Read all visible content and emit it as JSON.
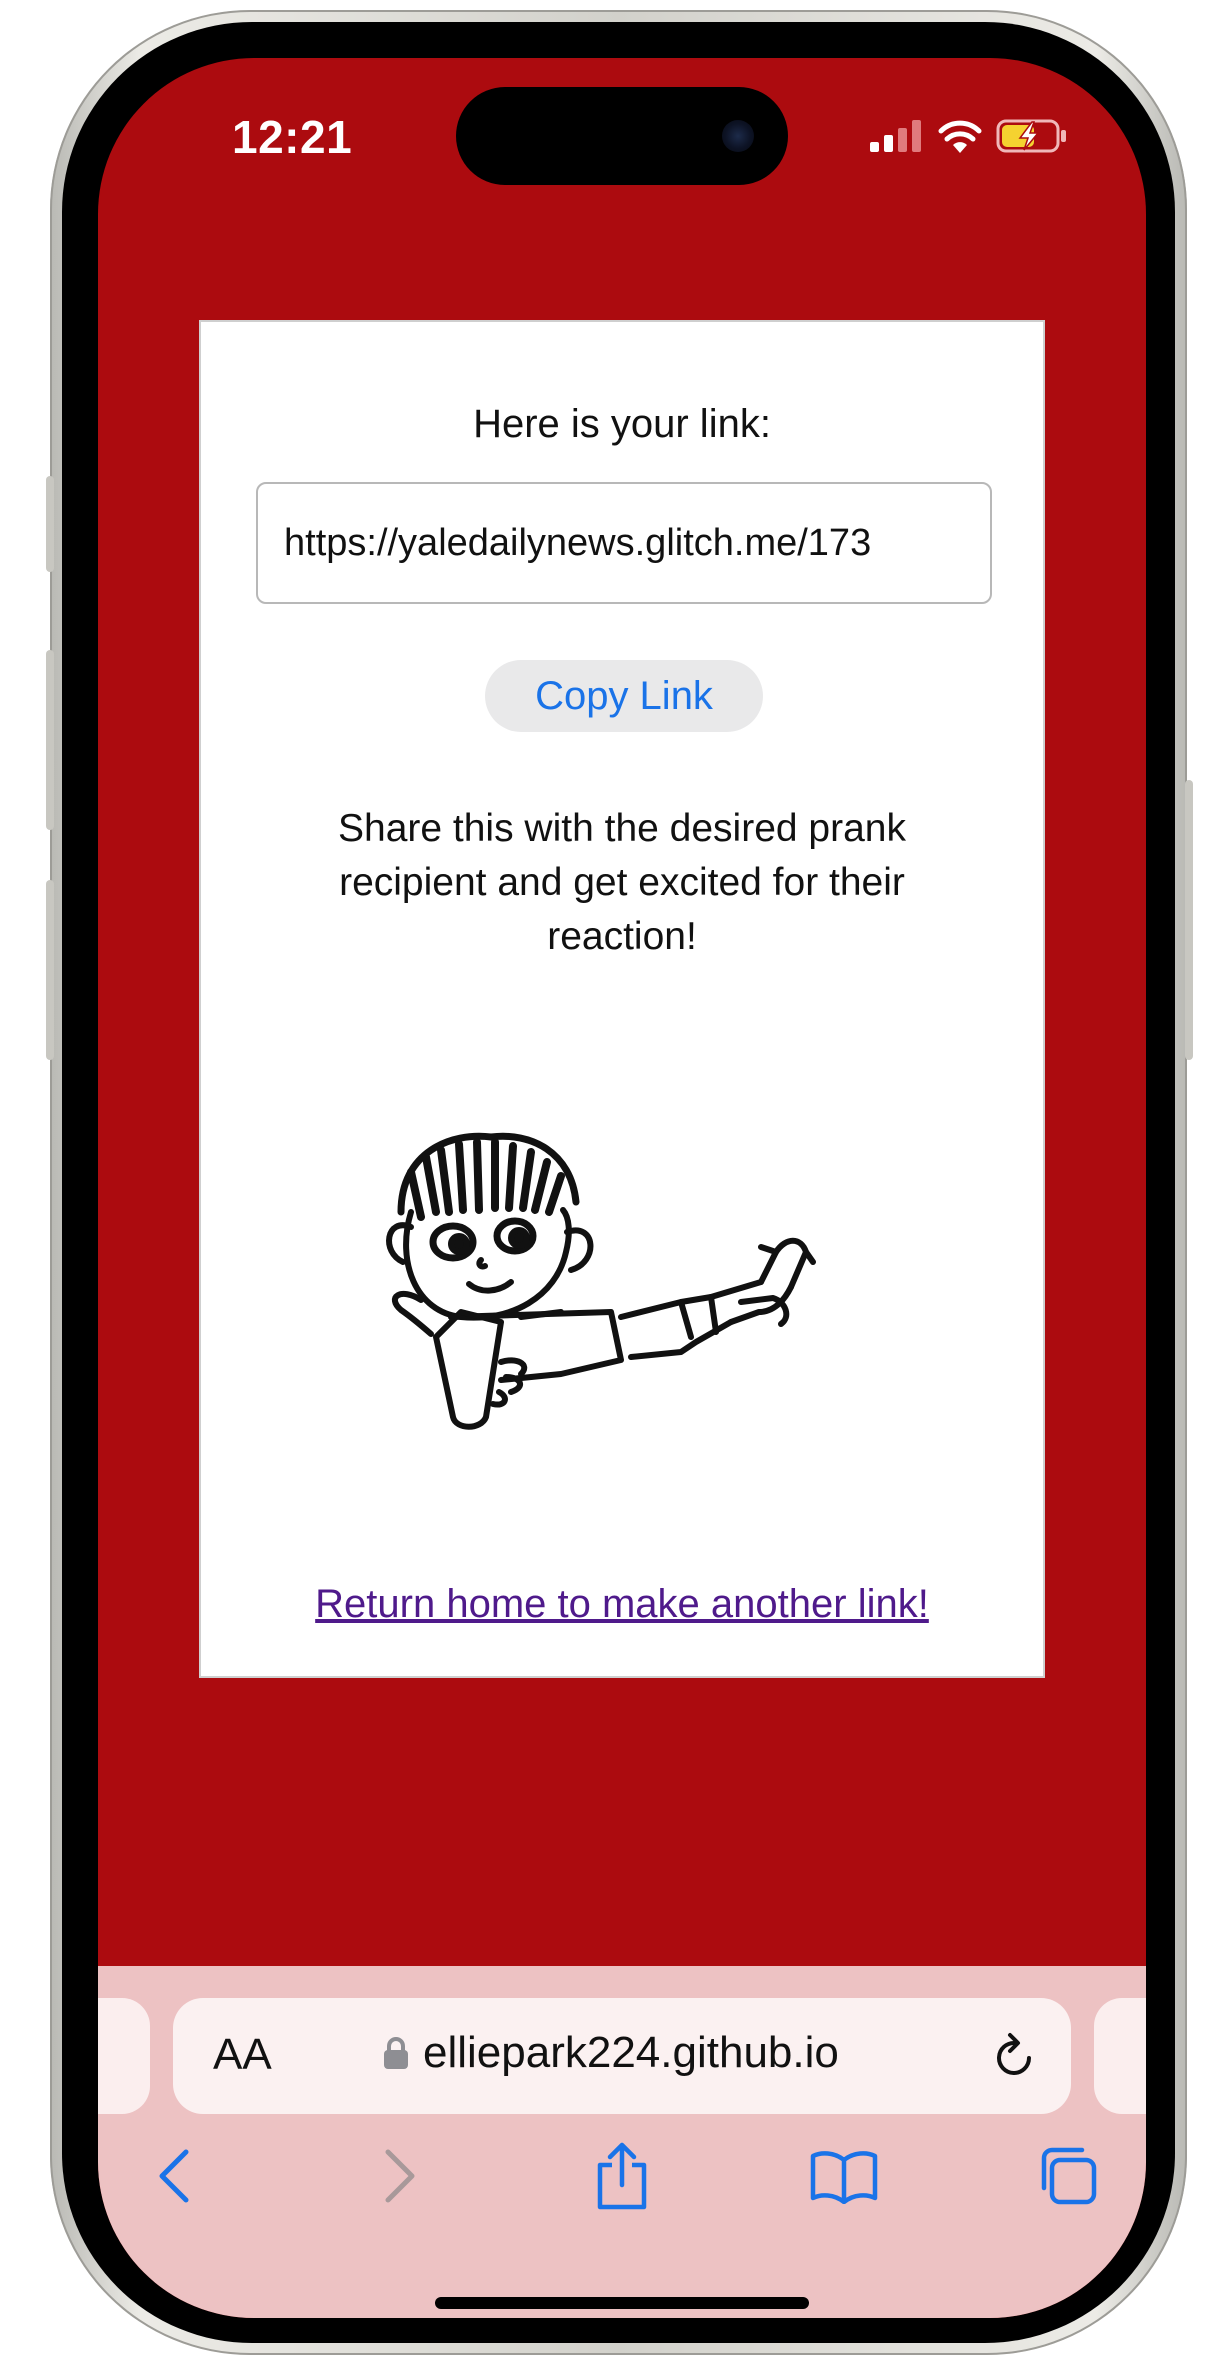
{
  "status_bar": {
    "time": "12:21",
    "icons": [
      "cellular-signal-icon",
      "wifi-icon",
      "battery-charging-icon"
    ]
  },
  "card": {
    "heading": "Here is your link:",
    "link_value": "https://yaledailynews.glitch.me/173",
    "copy_button": "Copy Link",
    "share_text": "Share this with the desired prank recipient and get excited for their reaction!",
    "return_link": "Return home to make another link!"
  },
  "browser": {
    "text_size_button": "AA",
    "url": "elliepark224.github.io",
    "nav_icons": [
      "back-icon",
      "forward-icon",
      "share-icon",
      "bookmarks-icon",
      "tabs-icon"
    ]
  },
  "colors": {
    "page_background": "#ac0b0f",
    "toolbar_background": "#edc2c3",
    "link_blue": "#1a73e8",
    "visited_link": "#4f1a8b"
  }
}
